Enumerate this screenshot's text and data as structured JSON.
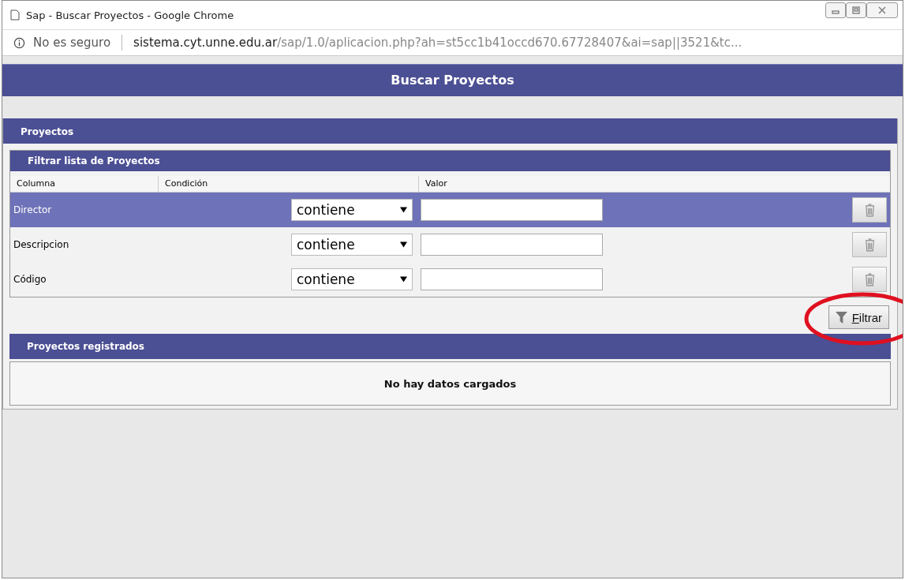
{
  "window": {
    "title": "Sap - Buscar Proyectos - Google Chrome"
  },
  "address_bar": {
    "security": "No es seguro",
    "domain": "sistema.cyt.unne.edu.ar",
    "path": "/sap/1.0/aplicacion.php?ah=st5cc1b41occd670.67728407&ai=sap||3521&tc..."
  },
  "page_title": "Buscar Proyectos",
  "panel": {
    "title": "Proyectos",
    "filter": {
      "title": "Filtrar lista de Proyectos",
      "columns": [
        "Columna",
        "Condición",
        "Valor"
      ],
      "rows": [
        {
          "label": "Director",
          "condition": "contiene",
          "selected": true
        },
        {
          "label": "Descripcion",
          "condition": "contiene",
          "selected": false
        },
        {
          "label": "Código",
          "condition": "contiene",
          "selected": false
        }
      ],
      "button": "Filtrar",
      "button_highlighted": true
    },
    "results": {
      "title": "Proyectos registrados",
      "empty": "No hay datos cargados"
    }
  }
}
